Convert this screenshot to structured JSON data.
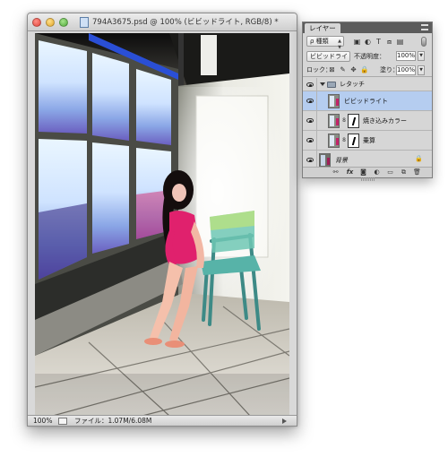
{
  "document": {
    "title": "794A3675.psd @ 100% (ビビッドライト, RGB/8) *",
    "status_zoom": "100%",
    "status_file": "ファイル：1.07M/6.08M"
  },
  "layers_panel": {
    "tab_label": "レイヤー",
    "filter_label": "ρ 種類",
    "blend_mode": "ビビッドライト",
    "opacity_label": "不透明度：",
    "opacity_value": "100%",
    "lock_label": "ロック：",
    "fill_label": "塗り：",
    "fill_value": "100%",
    "layers": [
      {
        "name": "レタッチ",
        "type": "group",
        "selected": false
      },
      {
        "name": "ビビッドライト",
        "type": "pixel",
        "selected": true
      },
      {
        "name": "焼き込みカラー",
        "type": "adjustment",
        "selected": false
      },
      {
        "name": "乗算",
        "type": "adjustment",
        "selected": false
      },
      {
        "name": "背景",
        "type": "background",
        "selected": false
      }
    ],
    "footer_icons": [
      "link-icon",
      "fx-icon",
      "mask-icon",
      "adjustment-icon",
      "folder-icon",
      "new-layer-icon",
      "trash-icon"
    ]
  },
  "colors": {
    "selection_highlight": "#b5cdf0",
    "panel_bg": "#d6d6d6",
    "dress": "#e0216d"
  }
}
